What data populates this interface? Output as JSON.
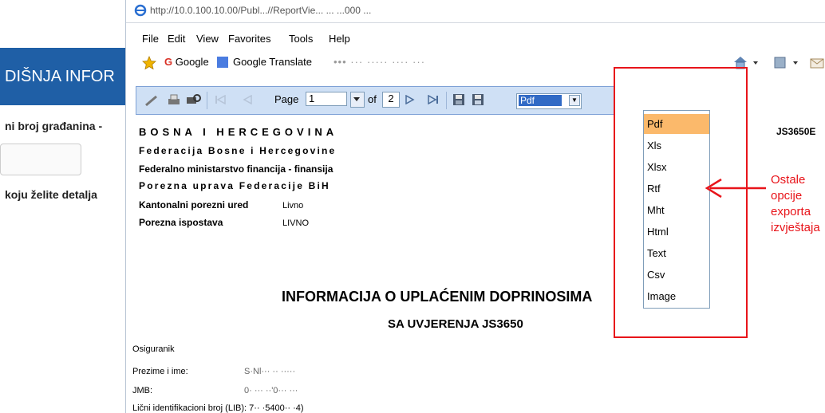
{
  "left_page": {
    "header": "DIŠNJA INFOR",
    "label1": "ni broj građanina -",
    "label2": "koju želite detalja"
  },
  "browser": {
    "url": "http://10.0.100.10.00/Publ...//ReportVie...   ...   ...000 ...",
    "menu": [
      "File",
      "Edit",
      "View",
      "Favorites",
      "Tools",
      "Help"
    ],
    "favorites": {
      "google": "Google",
      "translate": "Google Translate",
      "blurred": "•••   ···     ····· ···· ···"
    }
  },
  "toolbar": {
    "page_label": "Page",
    "page_value": "1",
    "of_label": "of",
    "total_pages": "2",
    "format_value": "Pdf"
  },
  "report": {
    "country": "BOSNA I HERCEGOVINA",
    "federation": "Federacija Bosne i Hercegovine",
    "ministry": "Federalno ministarstvo financija - finansija",
    "tax_admin": "Porezna uprava Federacije BiH",
    "cantonal_label": "Kantonalni porezni ured",
    "cantonal_value": "Livno",
    "branch_label": "Porezna ispostava",
    "branch_value": "LIVNO",
    "code": "JS3650E",
    "main_title": "INFORMACIJA O UPLAĆENIM DOPRINOSIMA",
    "sub_title": "SA UVJERENJA JS3650",
    "insured_label": "Osiguranik",
    "name_label": "Prezime i ime:",
    "name_value": "S·Nl··· ·· ·····",
    "jmb_label": "JMB:",
    "jmb_value": "0·  ··· ··'0··· ···",
    "lib_label": "Lični identifikacioni broj (LIB): 7·· ·5400·· ·4)"
  },
  "format_options": [
    "Pdf",
    "Xls",
    "Xlsx",
    "Rtf",
    "Mht",
    "Html",
    "Text",
    "Csv",
    "Image"
  ],
  "annotation": {
    "line1": "Ostale opcije",
    "line2": "exporta izvještaja",
    "color": "#e8141a"
  }
}
